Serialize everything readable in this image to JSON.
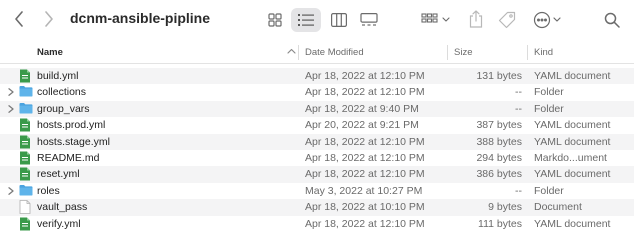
{
  "window": {
    "title": "dcnm-ansible-pipline"
  },
  "icons": {
    "back": "chevron-left-icon",
    "forward": "chevron-right-icon",
    "icon_view": "icon-grid-view-icon",
    "list_view": "list-view-icon",
    "column_view": "column-view-icon",
    "gallery_view": "gallery-view-icon",
    "group": "group-by-icon",
    "share": "share-icon",
    "tag": "tag-icon",
    "more": "more-actions-icon",
    "search": "search-icon"
  },
  "columns": {
    "name": "Name",
    "date": "Date Modified",
    "size": "Size",
    "kind": "Kind"
  },
  "files": [
    {
      "name": "build.yml",
      "date": "Apr 18, 2022 at 12:10 PM",
      "size": "131 bytes",
      "kind": "YAML document",
      "type": "yaml"
    },
    {
      "name": "collections",
      "date": "Apr 18, 2022 at 12:10 PM",
      "size": "--",
      "kind": "Folder",
      "type": "folder"
    },
    {
      "name": "group_vars",
      "date": "Apr 18, 2022 at 9:40 PM",
      "size": "--",
      "kind": "Folder",
      "type": "folder"
    },
    {
      "name": "hosts.prod.yml",
      "date": "Apr 20, 2022 at 9:21 PM",
      "size": "387 bytes",
      "kind": "YAML document",
      "type": "yaml"
    },
    {
      "name": "hosts.stage.yml",
      "date": "Apr 18, 2022 at 12:10 PM",
      "size": "388 bytes",
      "kind": "YAML document",
      "type": "yaml"
    },
    {
      "name": "README.md",
      "date": "Apr 18, 2022 at 12:10 PM",
      "size": "294 bytes",
      "kind": "Markdo...ument",
      "type": "yaml"
    },
    {
      "name": "reset.yml",
      "date": "Apr 18, 2022 at 12:10 PM",
      "size": "386 bytes",
      "kind": "YAML document",
      "type": "yaml"
    },
    {
      "name": "roles",
      "date": "May 3, 2022 at 10:27 PM",
      "size": "--",
      "kind": "Folder",
      "type": "folder"
    },
    {
      "name": "vault_pass",
      "date": "Apr 18, 2022 at 10:10 PM",
      "size": "9 bytes",
      "kind": "Document",
      "type": "doc"
    },
    {
      "name": "verify.yml",
      "date": "Apr 18, 2022 at 12:10 PM",
      "size": "111 bytes",
      "kind": "YAML document",
      "type": "yaml"
    }
  ],
  "colors": {
    "folder": "#4aa3df",
    "yaml": "#3a9a4a",
    "accent": "#1a73e8"
  }
}
